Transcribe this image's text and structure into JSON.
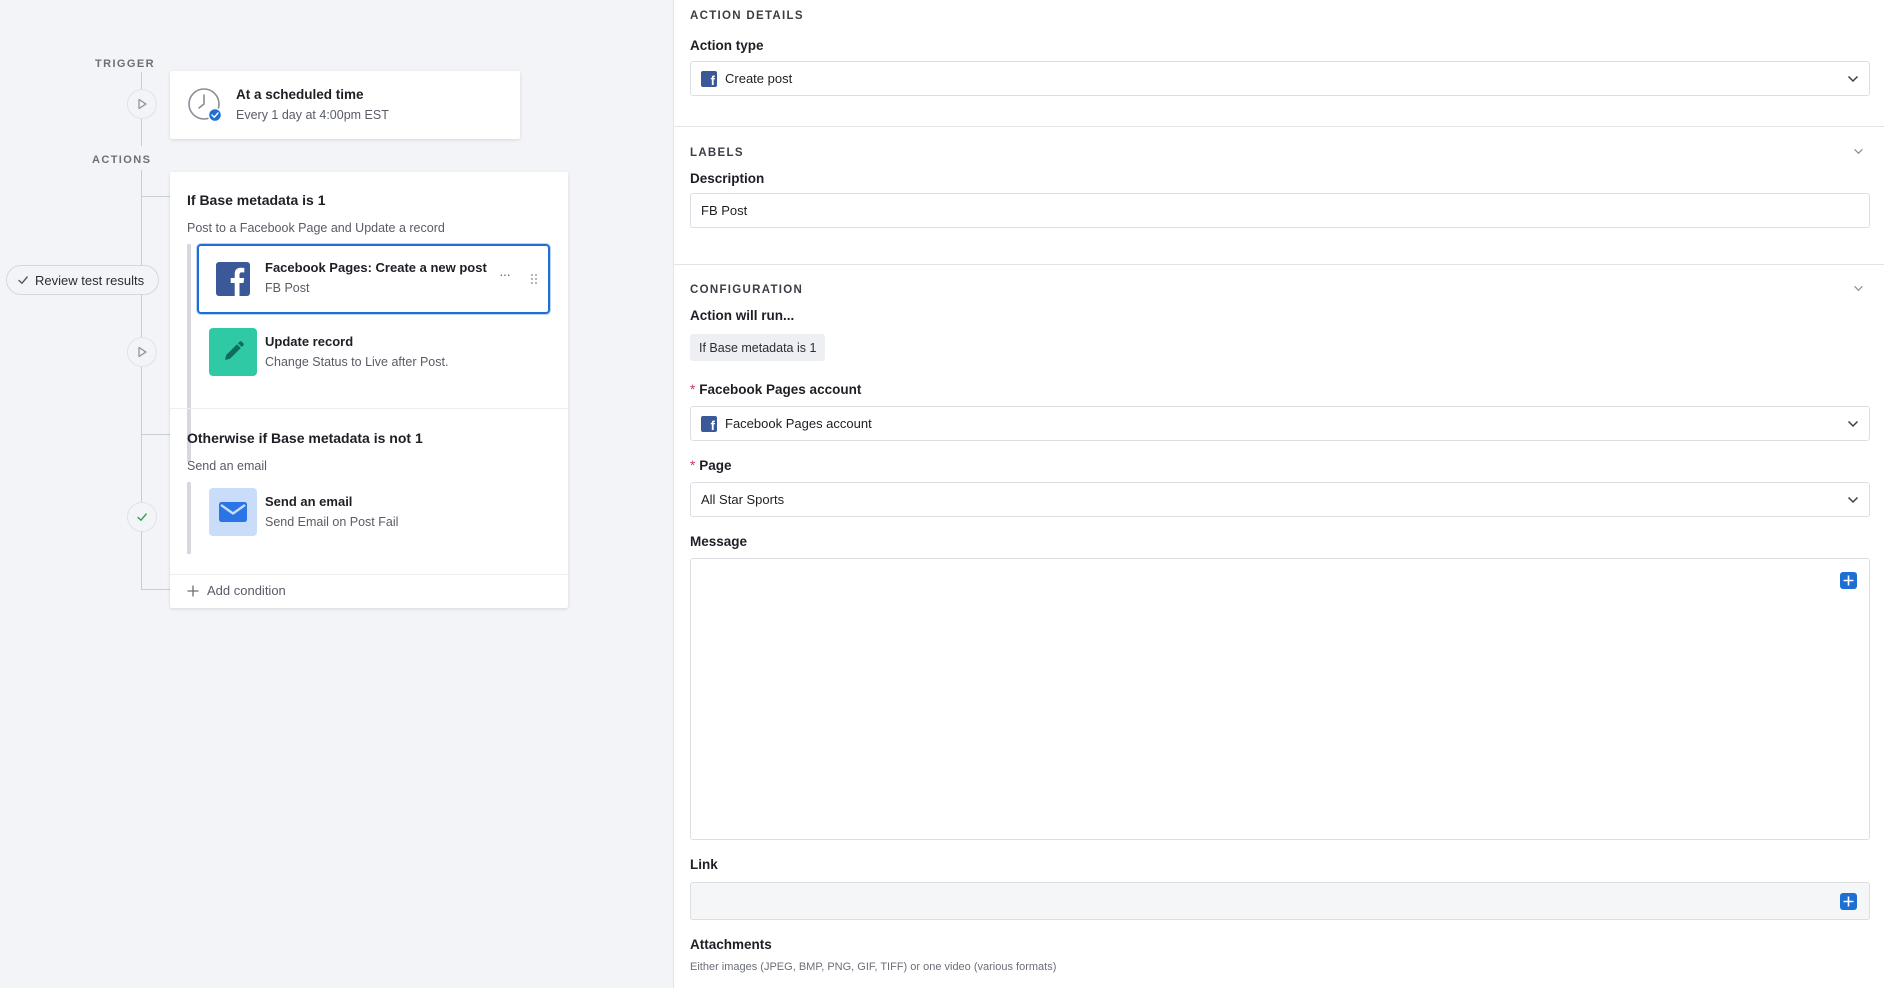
{
  "canvas": {
    "trigger_label": "TRIGGER",
    "actions_label": "ACTIONS",
    "review_button": "Review test results",
    "trigger_card": {
      "title": "At a scheduled time",
      "subtitle": "Every 1 day at 4:00pm EST",
      "icon": "clock-icon"
    },
    "condition1": {
      "title": "If Base metadata is 1",
      "subtitle": "Post to a Facebook Page and Update a record",
      "steps": [
        {
          "title": "Facebook Pages: Create a new post",
          "subtitle": "FB Post",
          "icon": "facebook-icon",
          "selected": true
        },
        {
          "title": "Update record",
          "subtitle": "Change Status to Live after Post.",
          "icon": "pencil-icon",
          "selected": false
        }
      ]
    },
    "condition2": {
      "title": "Otherwise if Base metadata is not 1",
      "subtitle": "Send an email",
      "steps": [
        {
          "title": "Send an email",
          "subtitle": "Send Email on Post Fail",
          "icon": "envelope-icon"
        }
      ]
    },
    "add_condition": "Add condition",
    "more_dots": "···"
  },
  "details": {
    "action_details_label": "ACTION DETAILS",
    "action_type_label": "Action type",
    "action_type_value": "Create post",
    "labels_section": "LABELS",
    "description_label": "Description",
    "description_value": "FB Post",
    "configuration_section": "CONFIGURATION",
    "action_will_run_label": "Action will run...",
    "action_will_run_chip": "If Base metadata is 1",
    "fb_account_label": "Facebook Pages account",
    "fb_account_value": "Facebook Pages account",
    "page_label": "Page",
    "page_value": "All Star Sports",
    "message_label": "Message",
    "link_label": "Link",
    "attachments_label": "Attachments",
    "attachments_hint": "Either images (JPEG, BMP, PNG, GIF, TIFF) or one video (various formats)",
    "required_mark": "*"
  },
  "colors": {
    "accent": "#1d6fd1",
    "facebook": "#3b5998",
    "update_green": "#2fc9a5",
    "email_blue": "#2b74e6",
    "required_red": "#d3345c"
  }
}
